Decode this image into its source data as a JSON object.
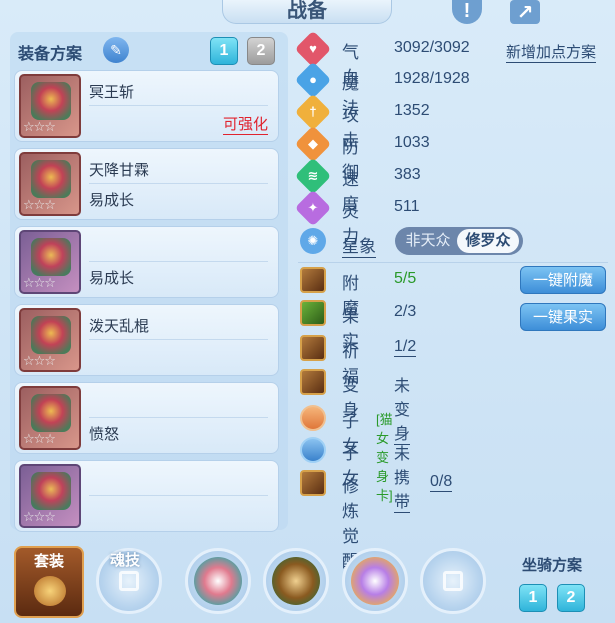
{
  "header": {
    "title": "战备",
    "info_icon": "info-icon",
    "share_icon": "share-icon"
  },
  "left": {
    "scheme_label": "装备方案",
    "scheme_buttons": [
      "1",
      "2"
    ],
    "equipment": [
      {
        "name": "冥王斩",
        "sub": "",
        "action": "可强化",
        "stars": "☆☆☆",
        "frame": "red"
      },
      {
        "name": "天降甘霖",
        "sub": "易成长",
        "action": "",
        "stars": "☆☆☆",
        "frame": "red"
      },
      {
        "name": "",
        "sub": "易成长",
        "action": "",
        "stars": "☆☆☆",
        "frame": "purple"
      },
      {
        "name": "泼天乱棍",
        "sub": "",
        "action": "",
        "stars": "☆☆☆",
        "frame": "red"
      },
      {
        "name": "",
        "sub": "愤怒",
        "action": "",
        "stars": "☆☆☆",
        "frame": "red"
      },
      {
        "name": "",
        "sub": "",
        "action": "",
        "stars": "☆☆☆",
        "frame": "purple"
      }
    ]
  },
  "stats": {
    "new_points_link": "新增加点方案",
    "items": [
      {
        "label": "气血",
        "value": "3092/3092",
        "color": "#e2566a",
        "glyph": "♥"
      },
      {
        "label": "魔法",
        "value": "1928/1928",
        "color": "#4aa3e6",
        "glyph": "●"
      },
      {
        "label": "攻击",
        "value": "1352",
        "color": "#f0b03c",
        "glyph": "†"
      },
      {
        "label": "防御",
        "value": "1033",
        "color": "#f0923c",
        "glyph": "◆"
      },
      {
        "label": "速度",
        "value": "383",
        "color": "#2fbf7a",
        "glyph": "≋"
      },
      {
        "label": "灵力",
        "value": "511",
        "color": "#b86ce0",
        "glyph": "✦"
      }
    ],
    "star_label": "星象",
    "star_options": [
      "非天众",
      "修罗众"
    ]
  },
  "features": [
    {
      "label": "附魔",
      "value": "5/5",
      "tag": ""
    },
    {
      "label": "果实",
      "value": "2/3",
      "tag": ""
    },
    {
      "label": "祈福",
      "value": "1/2",
      "tag": ""
    },
    {
      "label": "变身",
      "value": "未变身",
      "tag": ""
    },
    {
      "label": "子女",
      "value": "",
      "tag": "[猫女变身卡]"
    },
    {
      "label": "子女",
      "value": "未携带",
      "tag": ""
    },
    {
      "label": "修炼觉醒",
      "value": "0/8",
      "tag": ""
    }
  ],
  "actions": {
    "enchant_all": "一键附魔",
    "fruit_all": "一键果实"
  },
  "bottom": {
    "suit_label": "套装",
    "soul_label": "魂技",
    "mount_label": "坐骑方案",
    "mount_buttons": [
      "1",
      "2"
    ]
  }
}
